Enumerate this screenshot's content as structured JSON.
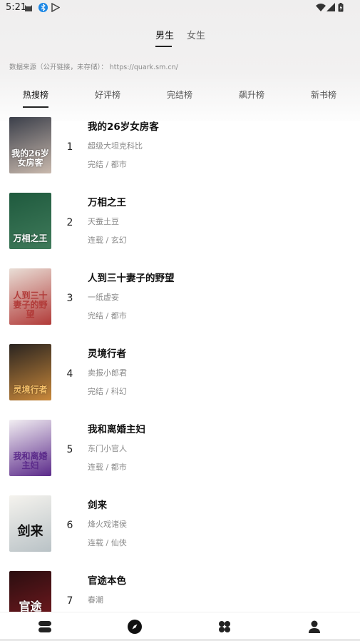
{
  "status_bar": {
    "time": "5:21",
    "icons": [
      "cat-icon",
      "bluetooth-icon",
      "play-store-icon",
      "wifi-icon",
      "signal-icon",
      "battery-icon"
    ]
  },
  "gender_tabs": [
    {
      "label": "男生",
      "active": true
    },
    {
      "label": "女生",
      "active": false
    }
  ],
  "source_note": "数据来源（公开链接，未存储）： https://quark.sm.cn/",
  "rank_tabs": [
    {
      "label": "热搜榜",
      "active": true
    },
    {
      "label": "好评榜",
      "active": false
    },
    {
      "label": "完结榜",
      "active": false
    },
    {
      "label": "飙升榜",
      "active": false
    },
    {
      "label": "新书榜",
      "active": false
    }
  ],
  "books": [
    {
      "rank": "1",
      "title": "我的26岁女房客",
      "author": "超级大坦克科比",
      "meta": "完结 / 都市",
      "cover_text": "我的26岁女房客",
      "cover_colors": [
        "#3b3f4a",
        "#c9b9ad"
      ]
    },
    {
      "rank": "2",
      "title": "万相之王",
      "author": "天蚕土豆",
      "meta": "连载 / 玄幻",
      "cover_text": "万相之王",
      "cover_colors": [
        "#1f5a3e",
        "#3f7a5a"
      ]
    },
    {
      "rank": "3",
      "title": "人到三十妻子的野望",
      "author": "一纸虚妄",
      "meta": "完结 / 都市",
      "cover_text": "人到三十妻子的野望",
      "cover_colors": [
        "#e9ded6",
        "#b13a38"
      ]
    },
    {
      "rank": "4",
      "title": "灵境行者",
      "author": "卖报小郎君",
      "meta": "完结 / 科幻",
      "cover_text": "灵境行者",
      "cover_colors": [
        "#2a2420",
        "#c9883a"
      ]
    },
    {
      "rank": "5",
      "title": "我和离婚主妇",
      "author": "东门小官人",
      "meta": "连载 / 都市",
      "cover_text": "我和离婚主妇",
      "cover_colors": [
        "#f2eef2",
        "#5b2a8a"
      ]
    },
    {
      "rank": "6",
      "title": "剑来",
      "author": "烽火戏诸侯",
      "meta": "连载 / 仙侠",
      "cover_text": "剑来",
      "cover_colors": [
        "#f5f3ee",
        "#b9c2c6"
      ]
    },
    {
      "rank": "7",
      "title": "官途本色",
      "author": "春潮",
      "meta": "",
      "cover_text": "官途",
      "cover_colors": [
        "#2a0e10",
        "#7a1a20"
      ]
    }
  ],
  "bottom_nav": [
    {
      "name": "bookshelf-icon"
    },
    {
      "name": "compass-icon"
    },
    {
      "name": "category-icon"
    },
    {
      "name": "profile-icon"
    }
  ]
}
